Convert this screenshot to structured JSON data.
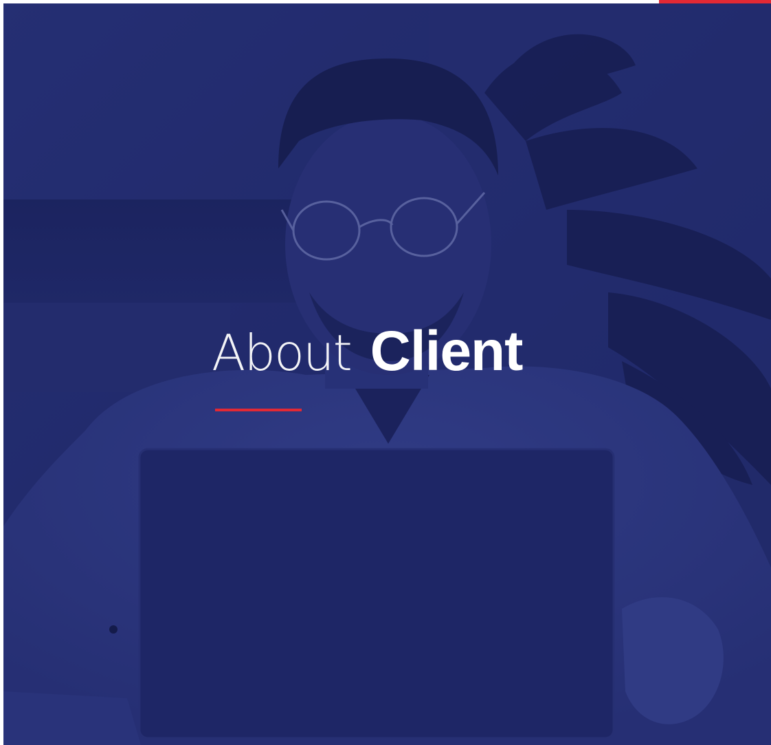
{
  "hero": {
    "title_light": "About",
    "title_bold": "Client"
  },
  "colors": {
    "accent": "#e32934",
    "overlay": "#202870",
    "text": "#ffffff"
  }
}
